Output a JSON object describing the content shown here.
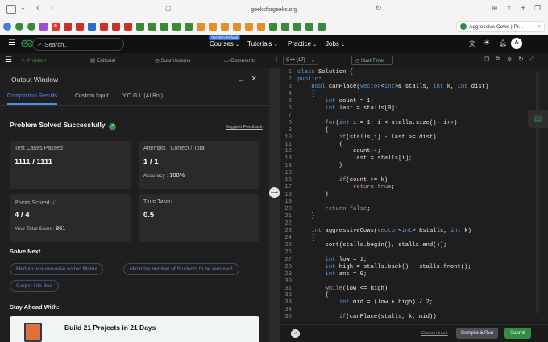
{
  "browser": {
    "url": "geeksforgeeks.org",
    "active_tab_title": "Aggressive Cows | Pr..."
  },
  "nav": {
    "search_placeholder": "Search...",
    "promo_badge": "Get 90% Refund",
    "items": [
      "Courses",
      "Tutorials",
      "Practice",
      "Jobs"
    ],
    "avatar_letter": "A"
  },
  "problem_tabs": [
    "Problem",
    "Editorial",
    "Submissions",
    "Comments"
  ],
  "output": {
    "title": "Output Window",
    "tabs": [
      "Compilation Results",
      "Custom Input",
      "Y.O.G.I. (AI Bot)"
    ],
    "status": "Problem Solved Successfully",
    "suggest_feedback": "Suggest Feedback",
    "test_cases_label": "Test Cases Passed",
    "test_cases_value": "1111 / 1111",
    "attempts_label": "Attempts : Correct / Total",
    "attempts_value": "1 / 1",
    "accuracy_label": "Accuracy :",
    "accuracy_value": "100%",
    "points_label": "Points Scored",
    "points_value": "4 / 4",
    "total_score_label": "Your Total Score:",
    "total_score_value": "861",
    "time_label": "Time Taken",
    "time_value": "0.5",
    "solve_next_title": "Solve Next",
    "solve_next": [
      "Median in a row-wise sorted Matrix",
      "Minimize number of Students to be removed",
      "Carpet into Box"
    ],
    "stay_ahead_title": "Stay Ahead With:",
    "banner_title": "Build 21 Projects in 21 Days"
  },
  "editor": {
    "language": "C++ (17)",
    "timer_label": "Start Timer",
    "custom_input_label": "Custom Input",
    "compile_label": "Compile & Run",
    "submit_label": "Submit",
    "code_lines": [
      "class Solution {",
      "public:",
      "    bool canPlace(vector<int>& stalls, int k, int dist)",
      "    {",
      "        int count = 1;",
      "        int last = stalls[0];",
      "",
      "        for(int i = 1; i < stalls.size(); i++)",
      "        {",
      "            if(stalls[i] - last >= dist)",
      "            {",
      "                count++;",
      "                last = stalls[i];",
      "            }",
      "",
      "            if(count >= k)",
      "                return true;",
      "        }",
      "",
      "        return false;",
      "    }",
      "",
      "    int aggressiveCows(vector<int> &stalls, int k)",
      "    {",
      "        sort(stalls.begin(), stalls.end());",
      "",
      "        int low = 1;",
      "        int high = stalls.back() - stalls.front();",
      "        int ans = 0;",
      "",
      "        while(low <= high)",
      "        {",
      "            int mid = (low + high) / 2;",
      "",
      "            if(canPlace(stalls, k, mid))"
    ]
  }
}
